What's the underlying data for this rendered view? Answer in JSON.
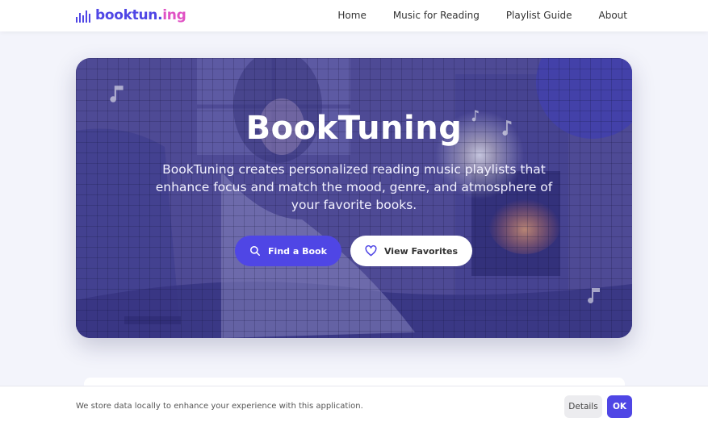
{
  "brand": {
    "name_main": "booktun.",
    "name_accent": "ing",
    "icon": "equalizer-bars-icon"
  },
  "nav": {
    "items": [
      "Home",
      "Music for Reading",
      "Playlist Guide",
      "About"
    ]
  },
  "hero": {
    "title": "BookTuning",
    "description": "BookTuning creates personalized reading music playlists that enhance focus and match the mood, genre, and atmosphere of your favorite books.",
    "primary_button": {
      "label": "Find a Book",
      "icon": "search-icon"
    },
    "secondary_button": {
      "label": "View Favorites",
      "icon": "heart-icon"
    }
  },
  "cookie": {
    "message": "We store data locally to enhance your experience with this application.",
    "details_label": "Details",
    "ok_label": "OK"
  },
  "colors": {
    "accent": "#4f46e5",
    "brand_accent": "#e052c4",
    "hero_overlay": "#3d3b8c"
  }
}
